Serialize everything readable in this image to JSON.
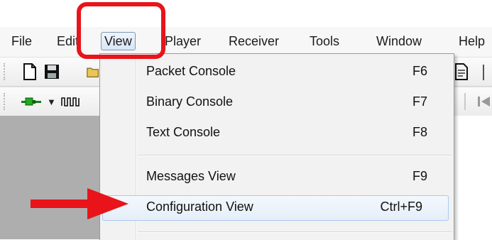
{
  "menubar": {
    "items": [
      {
        "label": "File"
      },
      {
        "label": "Edit"
      },
      {
        "label": "View",
        "active": true
      },
      {
        "label": "Player"
      },
      {
        "label": "Receiver"
      },
      {
        "label": "Tools"
      },
      {
        "label": "Window"
      },
      {
        "label": "Help"
      }
    ]
  },
  "toolbar": {
    "icons": [
      "new-file-icon",
      "save-icon",
      "open-folder-icon",
      "plugin-icon",
      "dropdown-arrow-icon",
      "pulse-wave-icon",
      "document-icon",
      "skip-back-icon"
    ]
  },
  "view_menu": {
    "items": [
      {
        "label": "Packet Console",
        "shortcut": "F6"
      },
      {
        "label": "Binary Console",
        "shortcut": "F7"
      },
      {
        "label": "Text Console",
        "shortcut": "F8"
      },
      {
        "label": "Messages View",
        "shortcut": "F9"
      },
      {
        "label": "Configuration View",
        "shortcut": "Ctrl+F9",
        "highlighted": true
      }
    ]
  },
  "annotations": {
    "highlight_color": "#e8141a",
    "arrow_color": "#e8141a"
  }
}
